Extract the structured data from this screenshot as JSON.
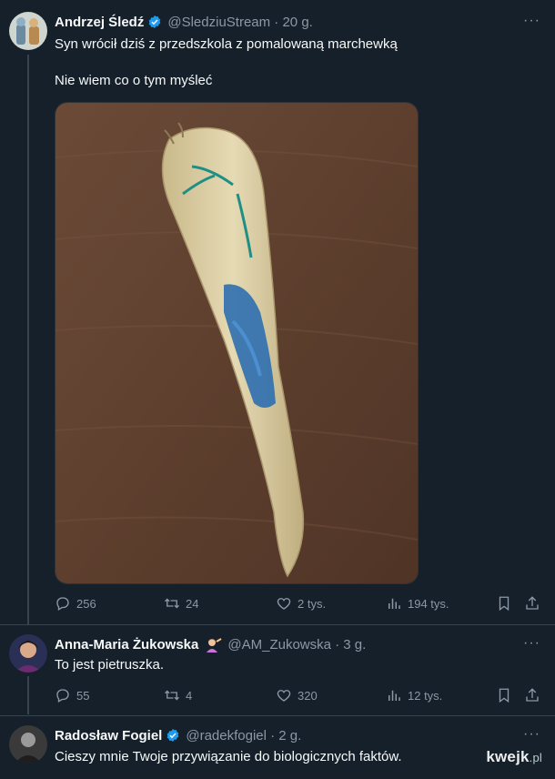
{
  "tweet1": {
    "name": "Andrzej Śledź",
    "handle": "@SledziuStream · 20 g.",
    "line1": "Syn wrócił dziś z przedszkola z pomalowaną marchewką",
    "line2": "Nie wiem co o tym myśleć",
    "stats": {
      "replies": "256",
      "retweets": "24",
      "likes": "2 tys.",
      "views": "194 tys."
    }
  },
  "tweet2": {
    "name": "Anna-Maria Żukowska",
    "handle": "@AM_Zukowska · 3 g.",
    "text": "To jest pietruszka.",
    "stats": {
      "replies": "55",
      "retweets": "4",
      "likes": "320",
      "views": "12 tys."
    }
  },
  "tweet3": {
    "name": "Radosław Fogiel",
    "handle": "@radekfogiel · 2 g.",
    "text": "Cieszy mnie Twoje przywiązanie do biologicznych faktów."
  },
  "more_icon": "···",
  "watermark": {
    "brand": "kwejk",
    "suffix": ".pl"
  },
  "colors": {
    "bg": "#15202b",
    "muted": "#8b98a5",
    "verified": "#1d9bf0"
  },
  "icons": [
    "reply-icon",
    "retweet-icon",
    "like-icon",
    "views-icon",
    "bookmark-icon",
    "share-icon",
    "verified-badge-icon"
  ]
}
